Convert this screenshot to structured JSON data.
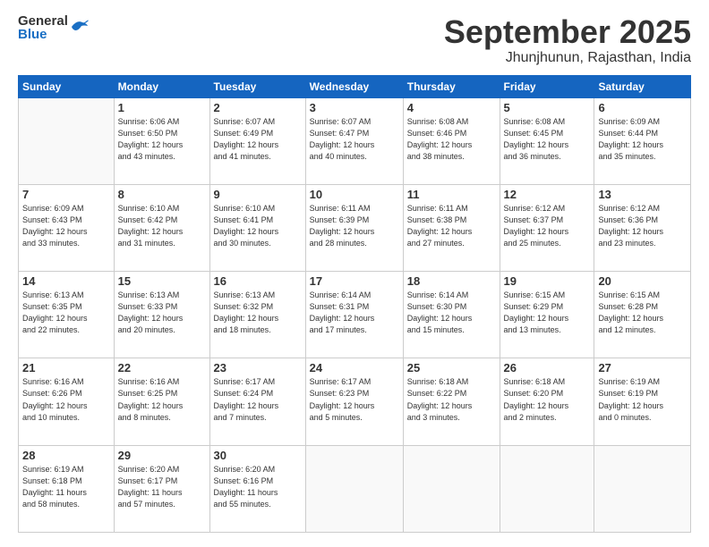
{
  "header": {
    "logo_general": "General",
    "logo_blue": "Blue",
    "month_title": "September 2025",
    "location": "Jhunjhunun, Rajasthan, India"
  },
  "calendar": {
    "days_of_week": [
      "Sunday",
      "Monday",
      "Tuesday",
      "Wednesday",
      "Thursday",
      "Friday",
      "Saturday"
    ],
    "weeks": [
      [
        {
          "day": "",
          "info": ""
        },
        {
          "day": "1",
          "info": "Sunrise: 6:06 AM\nSunset: 6:50 PM\nDaylight: 12 hours\nand 43 minutes."
        },
        {
          "day": "2",
          "info": "Sunrise: 6:07 AM\nSunset: 6:49 PM\nDaylight: 12 hours\nand 41 minutes."
        },
        {
          "day": "3",
          "info": "Sunrise: 6:07 AM\nSunset: 6:47 PM\nDaylight: 12 hours\nand 40 minutes."
        },
        {
          "day": "4",
          "info": "Sunrise: 6:08 AM\nSunset: 6:46 PM\nDaylight: 12 hours\nand 38 minutes."
        },
        {
          "day": "5",
          "info": "Sunrise: 6:08 AM\nSunset: 6:45 PM\nDaylight: 12 hours\nand 36 minutes."
        },
        {
          "day": "6",
          "info": "Sunrise: 6:09 AM\nSunset: 6:44 PM\nDaylight: 12 hours\nand 35 minutes."
        }
      ],
      [
        {
          "day": "7",
          "info": "Sunrise: 6:09 AM\nSunset: 6:43 PM\nDaylight: 12 hours\nand 33 minutes."
        },
        {
          "day": "8",
          "info": "Sunrise: 6:10 AM\nSunset: 6:42 PM\nDaylight: 12 hours\nand 31 minutes."
        },
        {
          "day": "9",
          "info": "Sunrise: 6:10 AM\nSunset: 6:41 PM\nDaylight: 12 hours\nand 30 minutes."
        },
        {
          "day": "10",
          "info": "Sunrise: 6:11 AM\nSunset: 6:39 PM\nDaylight: 12 hours\nand 28 minutes."
        },
        {
          "day": "11",
          "info": "Sunrise: 6:11 AM\nSunset: 6:38 PM\nDaylight: 12 hours\nand 27 minutes."
        },
        {
          "day": "12",
          "info": "Sunrise: 6:12 AM\nSunset: 6:37 PM\nDaylight: 12 hours\nand 25 minutes."
        },
        {
          "day": "13",
          "info": "Sunrise: 6:12 AM\nSunset: 6:36 PM\nDaylight: 12 hours\nand 23 minutes."
        }
      ],
      [
        {
          "day": "14",
          "info": "Sunrise: 6:13 AM\nSunset: 6:35 PM\nDaylight: 12 hours\nand 22 minutes."
        },
        {
          "day": "15",
          "info": "Sunrise: 6:13 AM\nSunset: 6:33 PM\nDaylight: 12 hours\nand 20 minutes."
        },
        {
          "day": "16",
          "info": "Sunrise: 6:13 AM\nSunset: 6:32 PM\nDaylight: 12 hours\nand 18 minutes."
        },
        {
          "day": "17",
          "info": "Sunrise: 6:14 AM\nSunset: 6:31 PM\nDaylight: 12 hours\nand 17 minutes."
        },
        {
          "day": "18",
          "info": "Sunrise: 6:14 AM\nSunset: 6:30 PM\nDaylight: 12 hours\nand 15 minutes."
        },
        {
          "day": "19",
          "info": "Sunrise: 6:15 AM\nSunset: 6:29 PM\nDaylight: 12 hours\nand 13 minutes."
        },
        {
          "day": "20",
          "info": "Sunrise: 6:15 AM\nSunset: 6:28 PM\nDaylight: 12 hours\nand 12 minutes."
        }
      ],
      [
        {
          "day": "21",
          "info": "Sunrise: 6:16 AM\nSunset: 6:26 PM\nDaylight: 12 hours\nand 10 minutes."
        },
        {
          "day": "22",
          "info": "Sunrise: 6:16 AM\nSunset: 6:25 PM\nDaylight: 12 hours\nand 8 minutes."
        },
        {
          "day": "23",
          "info": "Sunrise: 6:17 AM\nSunset: 6:24 PM\nDaylight: 12 hours\nand 7 minutes."
        },
        {
          "day": "24",
          "info": "Sunrise: 6:17 AM\nSunset: 6:23 PM\nDaylight: 12 hours\nand 5 minutes."
        },
        {
          "day": "25",
          "info": "Sunrise: 6:18 AM\nSunset: 6:22 PM\nDaylight: 12 hours\nand 3 minutes."
        },
        {
          "day": "26",
          "info": "Sunrise: 6:18 AM\nSunset: 6:20 PM\nDaylight: 12 hours\nand 2 minutes."
        },
        {
          "day": "27",
          "info": "Sunrise: 6:19 AM\nSunset: 6:19 PM\nDaylight: 12 hours\nand 0 minutes."
        }
      ],
      [
        {
          "day": "28",
          "info": "Sunrise: 6:19 AM\nSunset: 6:18 PM\nDaylight: 11 hours\nand 58 minutes."
        },
        {
          "day": "29",
          "info": "Sunrise: 6:20 AM\nSunset: 6:17 PM\nDaylight: 11 hours\nand 57 minutes."
        },
        {
          "day": "30",
          "info": "Sunrise: 6:20 AM\nSunset: 6:16 PM\nDaylight: 11 hours\nand 55 minutes."
        },
        {
          "day": "",
          "info": ""
        },
        {
          "day": "",
          "info": ""
        },
        {
          "day": "",
          "info": ""
        },
        {
          "day": "",
          "info": ""
        }
      ]
    ]
  }
}
